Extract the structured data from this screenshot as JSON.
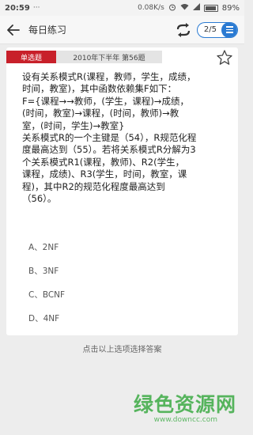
{
  "status_bar": {
    "time": "20:59",
    "dots": "···",
    "speed": "0.08K/s",
    "battery": "89%"
  },
  "header": {
    "title": "每日练习",
    "pager": "2/5"
  },
  "question": {
    "type_tag": "单选题",
    "exam_tag": "2010年下半年 第56题",
    "lines": [
      "设有关系模式R(课程，教师，学生，成绩，",
      "时间，教室)，其中函数依赖集F如下：",
      "F={课程→→教师，(学生，课程)→成绩，",
      "(时间，教室)→课程，(时间，教师)→教",
      "室，(时间，学生)→教室}",
      "关系模式R的一个主键是（54），R规范化程",
      "度最高达到（55）。若将关系模式R分解为3",
      "个关系模式R1(课程，教师)、R2(学生，",
      "课程，成绩)、R3(学生，时间，教室，课",
      "程)，其中R2的规范化程度最高达到",
      "（56）。"
    ]
  },
  "options": [
    "A、2NF",
    "B、3NF",
    "C、BCNF",
    "D、4NF"
  ],
  "hint": "点击以上选项选择答案",
  "watermark": {
    "main": "绿色资源网",
    "sub": "www.downcc.com"
  }
}
